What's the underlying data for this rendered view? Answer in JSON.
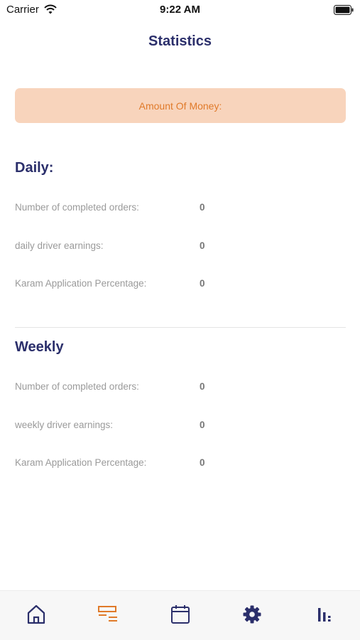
{
  "status_bar": {
    "carrier": "Carrier",
    "time": "9:22 AM"
  },
  "page": {
    "title": "Statistics"
  },
  "money_card": {
    "label": "Amount Of Money:"
  },
  "daily": {
    "title": "Daily:",
    "rows": [
      {
        "label": "Number of completed orders:",
        "value": "0"
      },
      {
        "label": "daily driver earnings:",
        "value": "0"
      },
      {
        "label": "Karam Application Percentage:",
        "value": "0"
      }
    ]
  },
  "weekly": {
    "title": "Weekly",
    "rows": [
      {
        "label": "Number of completed orders:",
        "value": "0"
      },
      {
        "label": "weekly driver earnings:",
        "value": "0"
      },
      {
        "label": "Karam Application Percentage:",
        "value": "0"
      }
    ]
  },
  "tab_bar": {
    "tabs": [
      {
        "icon": "home-icon",
        "active": false
      },
      {
        "icon": "orders-list-icon",
        "active": true
      },
      {
        "icon": "calendar-icon",
        "active": false
      },
      {
        "icon": "gear-icon",
        "active": false
      },
      {
        "icon": "statistics-bars-icon",
        "active": false
      }
    ]
  },
  "colors": {
    "primary": "#2b2f6b",
    "accent": "#e07a2a",
    "card_background": "#f8d4bc",
    "muted_text": "#9a9a9a"
  }
}
